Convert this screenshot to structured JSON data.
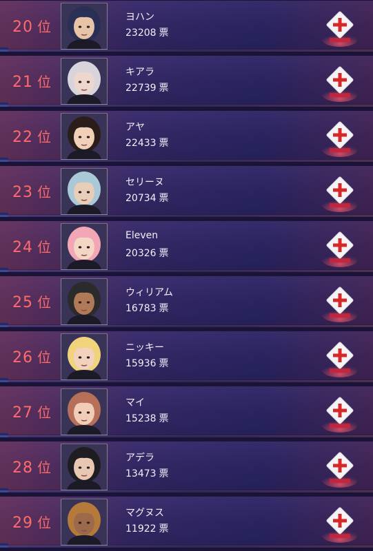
{
  "rank_suffix": "位",
  "vote_unit": "票",
  "colors": {
    "rank_text": "#ff6b6b",
    "vote_icon_red": "#d62828",
    "row_bg": "#2a2258"
  },
  "entries": [
    {
      "rank": "20",
      "name": "ヨハン",
      "votes": "23208",
      "hair": "#2a2f55",
      "skin": "#e7c3a8"
    },
    {
      "rank": "21",
      "name": "キアラ",
      "votes": "22739",
      "hair": "#d8d4dc",
      "skin": "#eed6cc"
    },
    {
      "rank": "22",
      "name": "アヤ",
      "votes": "22433",
      "hair": "#2b1e1a",
      "skin": "#f0d0b8"
    },
    {
      "rank": "23",
      "name": "セリーヌ",
      "votes": "20734",
      "hair": "#a9c9d6",
      "skin": "#e8cdb8"
    },
    {
      "rank": "24",
      "name": "Eleven",
      "votes": "20326",
      "hair": "#f2a6b6",
      "skin": "#f4d6c4"
    },
    {
      "rank": "25",
      "name": "ウィリアム",
      "votes": "16783",
      "hair": "#2b2b2b",
      "skin": "#b07a58"
    },
    {
      "rank": "26",
      "name": "ニッキー",
      "votes": "15936",
      "hair": "#f0d37a",
      "skin": "#f2d2bd"
    },
    {
      "rank": "27",
      "name": "マイ",
      "votes": "15238",
      "hair": "#b6705a",
      "skin": "#f1cdb8"
    },
    {
      "rank": "28",
      "name": "アデラ",
      "votes": "13473",
      "hair": "#1d1d22",
      "skin": "#e8c8b2"
    },
    {
      "rank": "29",
      "name": "マグヌス",
      "votes": "11922",
      "hair": "#b57a3a",
      "skin": "#9c6a4a"
    }
  ]
}
